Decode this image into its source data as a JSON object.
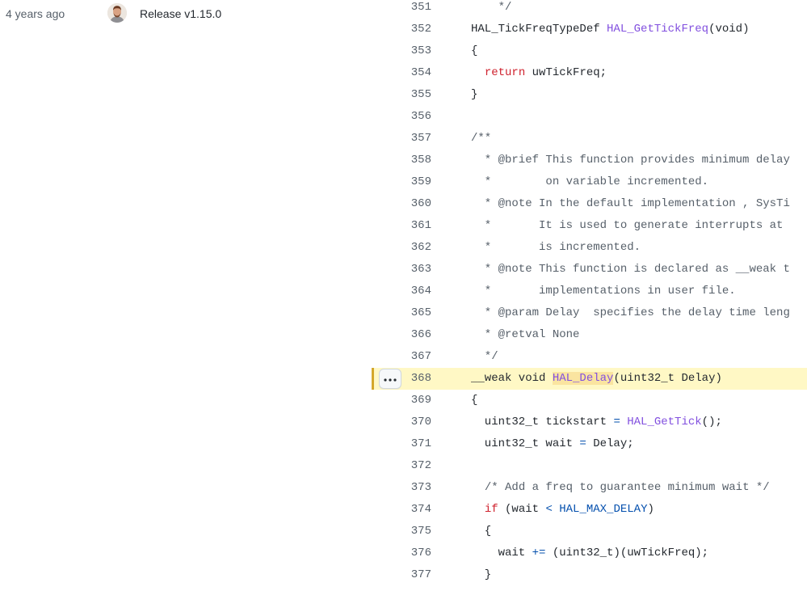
{
  "blame": {
    "age": "4 years ago",
    "message": "Release v1.15.0"
  },
  "colors": {
    "comment": "#57606a",
    "keyword": "#cf222e",
    "function": "#8250df",
    "constant": "#0550ae",
    "highlight_line_bg": "#fff8c5",
    "highlight_bar": "#d4a72c"
  },
  "code_lines": [
    {
      "number": "351",
      "tokens": [
        {
          "t": "    */",
          "c": "cmt"
        }
      ]
    },
    {
      "number": "352",
      "tokens": [
        {
          "t": "HAL_TickFreqTypeDef "
        },
        {
          "t": "HAL_GetTickFreq",
          "c": "fn"
        },
        {
          "t": "(void)"
        }
      ]
    },
    {
      "number": "353",
      "tokens": [
        {
          "t": "{"
        }
      ]
    },
    {
      "number": "354",
      "tokens": [
        {
          "t": "  "
        },
        {
          "t": "return",
          "c": "kw"
        },
        {
          "t": " uwTickFreq;"
        }
      ]
    },
    {
      "number": "355",
      "tokens": [
        {
          "t": "}"
        }
      ]
    },
    {
      "number": "356",
      "tokens": []
    },
    {
      "number": "357",
      "tokens": [
        {
          "t": "/**",
          "c": "cmt"
        }
      ]
    },
    {
      "number": "358",
      "tokens": [
        {
          "t": "  * @brief This function provides minimum delay",
          "c": "cmt"
        }
      ]
    },
    {
      "number": "359",
      "tokens": [
        {
          "t": "  *        on variable incremented.",
          "c": "cmt"
        }
      ]
    },
    {
      "number": "360",
      "tokens": [
        {
          "t": "  * @note In the default implementation , SysTi",
          "c": "cmt"
        }
      ]
    },
    {
      "number": "361",
      "tokens": [
        {
          "t": "  *       It is used to generate interrupts at",
          "c": "cmt"
        }
      ]
    },
    {
      "number": "362",
      "tokens": [
        {
          "t": "  *       is incremented.",
          "c": "cmt"
        }
      ]
    },
    {
      "number": "363",
      "tokens": [
        {
          "t": "  * @note This function is declared as __weak t",
          "c": "cmt"
        }
      ]
    },
    {
      "number": "364",
      "tokens": [
        {
          "t": "  *       implementations in user file.",
          "c": "cmt"
        }
      ]
    },
    {
      "number": "365",
      "tokens": [
        {
          "t": "  * @param Delay  specifies the delay time leng",
          "c": "cmt"
        }
      ]
    },
    {
      "number": "366",
      "tokens": [
        {
          "t": "  * @retval None",
          "c": "cmt"
        }
      ]
    },
    {
      "number": "367",
      "tokens": [
        {
          "t": "  */",
          "c": "cmt"
        }
      ]
    },
    {
      "number": "368",
      "highlighted": true,
      "tokens": [
        {
          "t": "__weak void "
        },
        {
          "t": "HAL_Delay",
          "c": "fn-hl"
        },
        {
          "t": "(uint32_t Delay)"
        }
      ]
    },
    {
      "number": "369",
      "tokens": [
        {
          "t": "{"
        }
      ]
    },
    {
      "number": "370",
      "tokens": [
        {
          "t": "  uint32_t tickstart "
        },
        {
          "t": "=",
          "c": "op"
        },
        {
          "t": " "
        },
        {
          "t": "HAL_GetTick",
          "c": "fn"
        },
        {
          "t": "();"
        }
      ]
    },
    {
      "number": "371",
      "tokens": [
        {
          "t": "  uint32_t wait "
        },
        {
          "t": "=",
          "c": "op"
        },
        {
          "t": " Delay;"
        }
      ]
    },
    {
      "number": "372",
      "tokens": []
    },
    {
      "number": "373",
      "tokens": [
        {
          "t": "  "
        },
        {
          "t": "/* Add a freq to guarantee minimum wait */",
          "c": "cmt"
        }
      ]
    },
    {
      "number": "374",
      "tokens": [
        {
          "t": "  "
        },
        {
          "t": "if",
          "c": "kw"
        },
        {
          "t": " (wait "
        },
        {
          "t": "<",
          "c": "op"
        },
        {
          "t": " "
        },
        {
          "t": "HAL_MAX_DELAY",
          "c": "const"
        },
        {
          "t": ")"
        }
      ]
    },
    {
      "number": "375",
      "tokens": [
        {
          "t": "  {"
        }
      ]
    },
    {
      "number": "376",
      "tokens": [
        {
          "t": "    wait "
        },
        {
          "t": "+=",
          "c": "op"
        },
        {
          "t": " (uint32_t)(uwTickFreq);"
        }
      ]
    },
    {
      "number": "377",
      "tokens": [
        {
          "t": "  }"
        }
      ]
    }
  ]
}
